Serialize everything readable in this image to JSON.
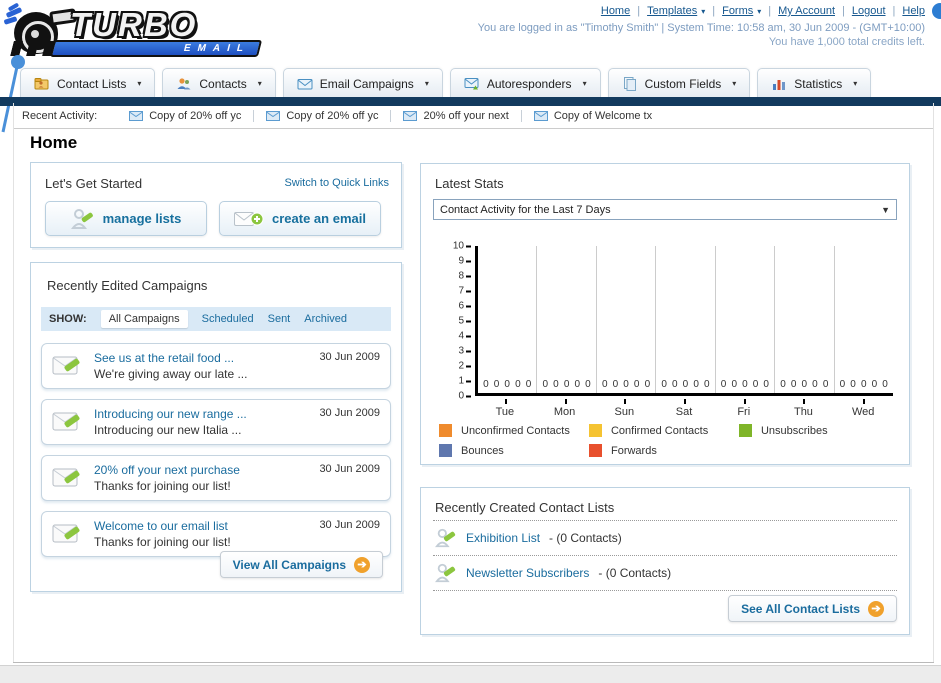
{
  "header": {
    "logo_title": "TURBO",
    "logo_subtitle": "EMAIL",
    "nav_links": [
      {
        "label": "Home",
        "dropdown": false
      },
      {
        "label": "Templates",
        "dropdown": true
      },
      {
        "label": "Forms",
        "dropdown": true
      },
      {
        "label": "My Account",
        "dropdown": false
      },
      {
        "label": "Logout",
        "dropdown": false
      },
      {
        "label": "Help",
        "dropdown": false
      }
    ],
    "login_info": "You are logged in as \"Timothy Smith\" | System Time: 10:58 am, 30 Jun 2009 - (GMT+10:00)",
    "credits_info": "You have 1,000 total credits left."
  },
  "nav_tabs": [
    {
      "label": "Contact Lists",
      "icon": "contact-lists-icon"
    },
    {
      "label": "Contacts",
      "icon": "contacts-icon"
    },
    {
      "label": "Email Campaigns",
      "icon": "email-campaigns-icon"
    },
    {
      "label": "Autoresponders",
      "icon": "autoresponders-icon"
    },
    {
      "label": "Custom Fields",
      "icon": "custom-fields-icon"
    },
    {
      "label": "Statistics",
      "icon": "statistics-icon"
    }
  ],
  "recent_activity": {
    "label": "Recent Activity:",
    "items": [
      "Copy of 20% off yc",
      "Copy of 20% off yc",
      "20% off your next ",
      "Copy of Welcome tx"
    ]
  },
  "page_title": "Home",
  "get_started": {
    "title": "Let's Get Started",
    "switch_link_label": "Switch to Quick Links",
    "manage_lists_label": "manage lists",
    "create_email_label": "create an email"
  },
  "campaigns": {
    "title": "Recently Edited Campaigns",
    "show_label": "SHOW:",
    "filters": [
      "All Campaigns",
      "Scheduled",
      "Sent",
      "Archived"
    ],
    "active_filter": "All Campaigns",
    "items": [
      {
        "title": "See us at the retail food ...",
        "subtitle": "We're giving away our late ...",
        "date": "30 Jun 2009"
      },
      {
        "title": "Introducing our new range ...",
        "subtitle": "Introducing our new Italia ...",
        "date": "30 Jun 2009"
      },
      {
        "title": "20% off your next purchase",
        "subtitle": "Thanks for joining our list!",
        "date": "30 Jun 2009"
      },
      {
        "title": "Welcome to our email list",
        "subtitle": "Thanks for joining our list!",
        "date": "30 Jun 2009"
      }
    ],
    "view_all_label": "View All Campaigns"
  },
  "stats": {
    "title": "Latest Stats",
    "period_selector_value": "Contact Activity for the Last 7 Days"
  },
  "chart_data": {
    "type": "bar",
    "title": "Contact Activity for the Last 7 Days",
    "categories": [
      "Tue",
      "Mon",
      "Sun",
      "Sat",
      "Fri",
      "Thu",
      "Wed"
    ],
    "series": [
      {
        "name": "Unconfirmed Contacts",
        "color": "#ef8b2d",
        "values": [
          0,
          0,
          0,
          0,
          0,
          0,
          0
        ]
      },
      {
        "name": "Confirmed Contacts",
        "color": "#f5c332",
        "values": [
          0,
          0,
          0,
          0,
          0,
          0,
          0
        ]
      },
      {
        "name": "Unsubscribes",
        "color": "#7fb529",
        "values": [
          0,
          0,
          0,
          0,
          0,
          0,
          0
        ]
      },
      {
        "name": "Bounces",
        "color": "#5f77ae",
        "values": [
          0,
          0,
          0,
          0,
          0,
          0,
          0
        ]
      },
      {
        "name": "Forwards",
        "color": "#e8502d",
        "values": [
          0,
          0,
          0,
          0,
          0,
          0,
          0
        ]
      }
    ],
    "ylim": [
      0,
      10
    ],
    "yticks": [
      0,
      1,
      2,
      3,
      4,
      5,
      6,
      7,
      8,
      9,
      10
    ],
    "value_labels_shown": true,
    "legend_position": "bottom",
    "grid": "vertical"
  },
  "contact_lists": {
    "title": "Recently Created Contact Lists",
    "items": [
      {
        "name": "Exhibition List",
        "suffix": "- (0 Contacts)"
      },
      {
        "name": "Newsletter Subscribers",
        "suffix": "- (0 Contacts)"
      }
    ],
    "see_all_label": "See All Contact Lists"
  },
  "colors": {
    "navy_bar": "#123a5e",
    "link_blue": "#1a6c9e",
    "panel_border": "#bcd2e2",
    "orange_accent": "#f0a12c"
  }
}
